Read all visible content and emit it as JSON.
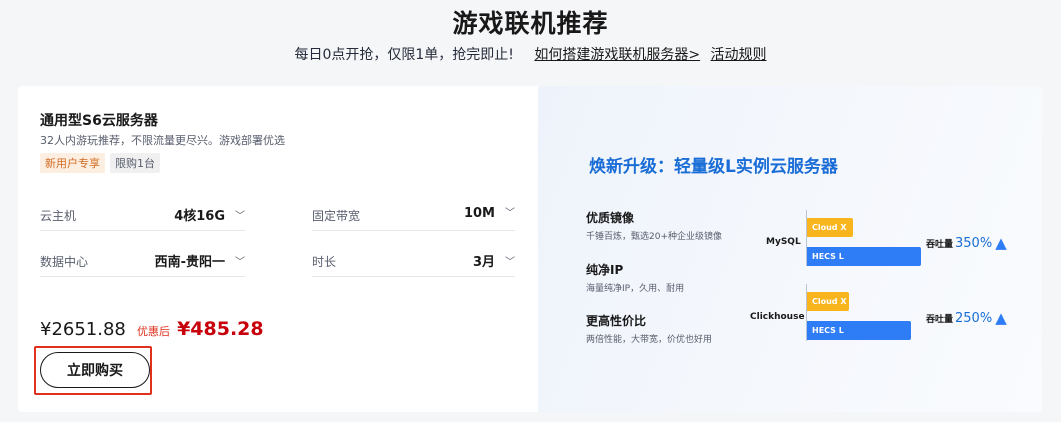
{
  "header": {
    "title": "游戏联机推荐",
    "subtitle": "每日0点开抢，仅限1单，抢完即止!",
    "link_guide": "如何搭建游戏联机服务器>",
    "link_rules": "活动规则"
  },
  "product": {
    "title": "通用型S6云服务器",
    "desc": "32人内游玩推荐，不限流量更尽兴。游戏部署优选",
    "tags": [
      "新用户专享",
      "限购1台"
    ],
    "specs": {
      "host": {
        "label": "云主机",
        "value": "4核16G"
      },
      "bandwidth": {
        "label": "固定带宽",
        "value": "10M"
      },
      "datacenter": {
        "label": "数据中心",
        "value": "西南-贵阳一"
      },
      "duration": {
        "label": "时长",
        "value": "3月"
      }
    },
    "price_original": "¥2651.88",
    "price_tip": "优惠后",
    "price_final": "¥485.28",
    "buy_label": "立即购买"
  },
  "promo": {
    "title": "焕新升级：轻量级L实例云服务器",
    "features": [
      {
        "title": "优质镜像",
        "desc": "千锤百炼，甄选20+种企业级镜像"
      },
      {
        "title": "纯净IP",
        "desc": "海量纯净IP，久用、耐用"
      },
      {
        "title": "更高性价比",
        "desc": "两倍性能，大带宽，价优也好用"
      }
    ],
    "comparisons": [
      {
        "name": "MySQL",
        "bar_yellow": "Cloud X",
        "bar_blue": "HECS L",
        "metric_label": "吞吐量",
        "metric_value": "350%",
        "yellow_ratio": 0.35,
        "blue_ratio": 0.88
      },
      {
        "name": "Clickhouse",
        "bar_yellow": "Cloud X",
        "bar_blue": "HECS L",
        "metric_label": "吞吐量",
        "metric_value": "250%",
        "yellow_ratio": 0.32,
        "blue_ratio": 0.8
      }
    ]
  },
  "colors": {
    "accent_blue": "#1a6dd6",
    "bar_yellow": "#f8b51d",
    "bar_blue": "#2e7cf6",
    "price_red": "#c7000b"
  }
}
